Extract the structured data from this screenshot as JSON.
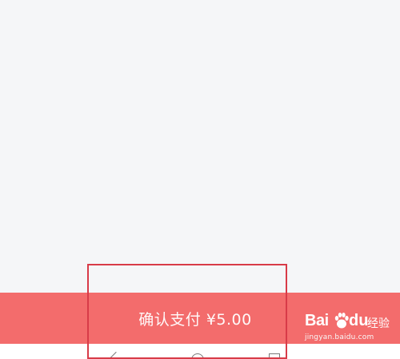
{
  "payment": {
    "confirm_label": "确认支付 ¥5.00"
  },
  "colors": {
    "pay_bar": "#f36c6c",
    "highlight_border": "#d83b48",
    "background": "#f5f6f8"
  },
  "navigation": {
    "icons": [
      "back-icon",
      "home-icon",
      "recent-apps-icon"
    ]
  },
  "watermark": {
    "brand_latin": "Bai",
    "brand_suffix": "du",
    "brand_cn": "经验",
    "url": "jingyan.baidu.com"
  }
}
